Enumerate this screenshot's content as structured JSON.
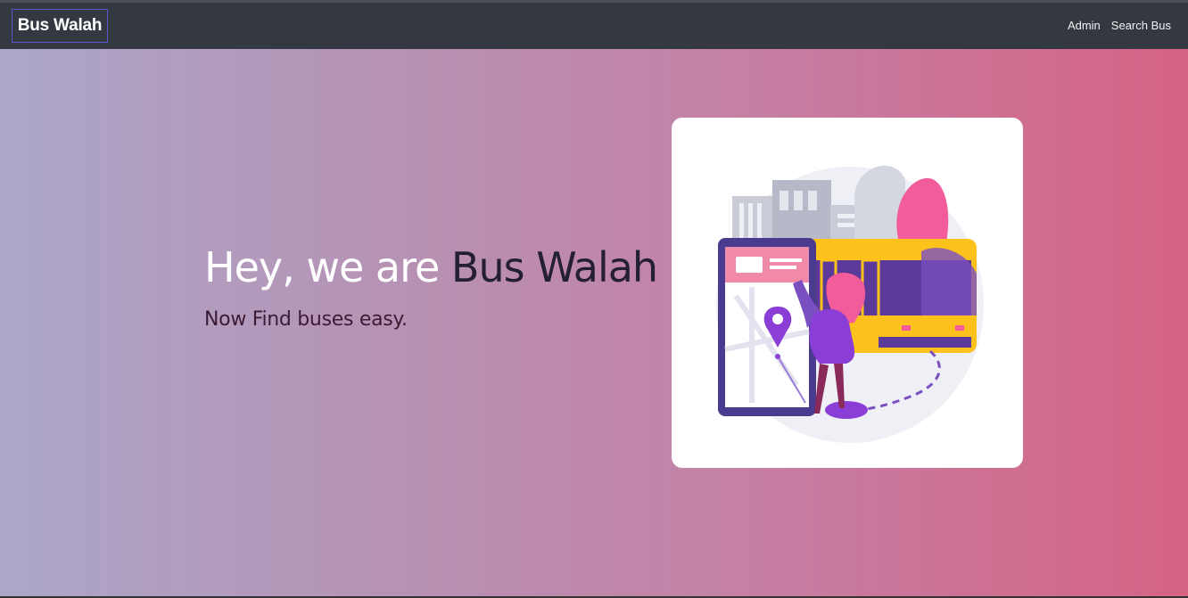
{
  "navbar": {
    "brand": "Bus Walah",
    "links": [
      {
        "label": "Admin"
      },
      {
        "label": "Search Bus"
      }
    ]
  },
  "hero": {
    "title_part1": "Hey, we are ",
    "title_part2": "Bus Walah",
    "subtitle": "Now Find buses easy."
  },
  "illustration": {
    "icon": "bus-stop-illustration",
    "colors": {
      "bus_yellow": "#fcc21b",
      "bus_purple": "#5b3a9a",
      "accent_pink": "#f25c9a",
      "pin_purple": "#8a3ed6",
      "building_gray": "#c9ccd6"
    }
  }
}
